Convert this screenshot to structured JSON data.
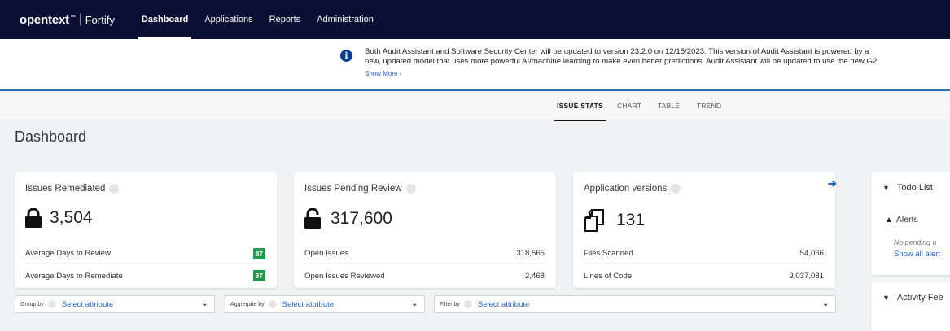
{
  "nav": {
    "brand": "opentext",
    "brand_tm": "™",
    "product": "Fortify",
    "items": [
      {
        "label": "Dashboard"
      },
      {
        "label": "Applications"
      },
      {
        "label": "Reports"
      },
      {
        "label": "Administration"
      }
    ]
  },
  "banner": {
    "message_line1": "Both Audit Assistant and Software Security Center will be updated to version 23.2.0 on 12/15/2023. This version of Audit Assistant is powered by a",
    "message_line2": "new, updated model that uses more powerful AI/machine learning to make even better predictions. Audit Assistant will be updated to use the new G2",
    "show_more": "Show More ›"
  },
  "tabs": [
    {
      "label": "ISSUE STATS"
    },
    {
      "label": "CHART"
    },
    {
      "label": "TABLE"
    },
    {
      "label": "TREND"
    }
  ],
  "page_title": "Dashboard",
  "cards": [
    {
      "title": "Issues Remediated",
      "value": "3,504",
      "row1_label": "Average Days to Review",
      "row1_value": "87",
      "row2_label": "Average Days to Remediate",
      "row2_value": "87"
    },
    {
      "title": "Issues Pending Review",
      "value": "317,600",
      "row1_label": "Open Issues",
      "row1_value": "318,565",
      "row2_label": "Open Issues Reviewed",
      "row2_value": "2,468"
    },
    {
      "title": "Application versions",
      "value": "131",
      "row1_label": "Files Scanned",
      "row1_value": "54,066",
      "row2_label": "Lines of Code",
      "row2_value": "9,037,081"
    }
  ],
  "todo": {
    "title": "Todo List",
    "alerts_label": "Alerts",
    "no_pending": "No pending u",
    "show_all": "Show all alert"
  },
  "activity": {
    "title": "Activity Fee"
  },
  "filters": {
    "group_by_label": "Group by",
    "group_by_value": "Select attribute",
    "aggregate_by_label": "Aggregate by",
    "aggregate_by_value": "Select attribute",
    "filter_by_label": "Filter by",
    "filter_by_value": "Select attribute"
  },
  "colors": {
    "nav_bg": "#0b0f33",
    "accent": "#1f63c6",
    "badge_green": "#1f9a4a",
    "banner_border": "#2a6ebb"
  }
}
